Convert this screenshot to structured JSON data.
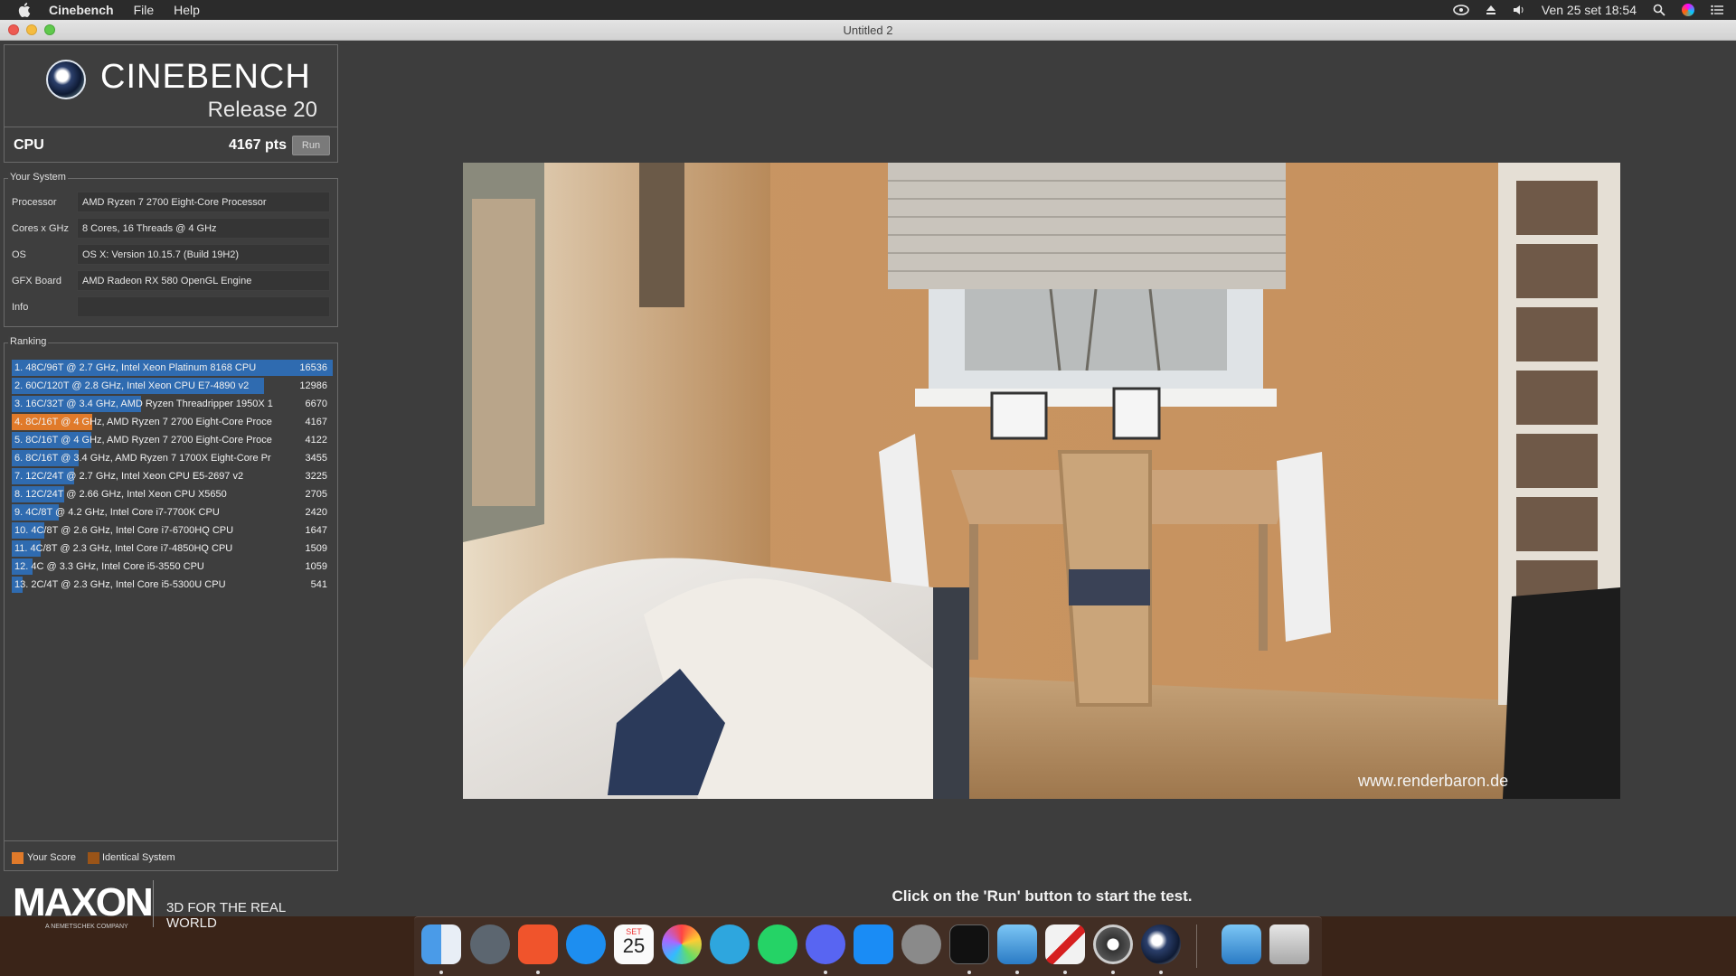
{
  "menubar": {
    "app": "Cinebench",
    "file": "File",
    "help": "Help",
    "datetime": "Ven 25 set  18:54"
  },
  "window": {
    "title": "Untitled 2"
  },
  "logo": {
    "title": "CINEBENCH",
    "subtitle": "Release 20"
  },
  "cpu": {
    "label": "CPU",
    "score": "4167 pts",
    "run": "Run"
  },
  "system": {
    "legend": "Your System",
    "rows": [
      {
        "key": "Processor",
        "value": "AMD Ryzen 7 2700 Eight-Core Processor"
      },
      {
        "key": "Cores x GHz",
        "value": "8 Cores, 16 Threads @ 4 GHz"
      },
      {
        "key": "OS",
        "value": "OS X: Version 10.15.7 (Build 19H2)"
      },
      {
        "key": "GFX Board",
        "value": "AMD Radeon RX 580 OpenGL Engine"
      },
      {
        "key": "Info",
        "value": ""
      }
    ]
  },
  "ranking": {
    "legend": "Ranking",
    "items": [
      {
        "label": "1. 48C/96T @ 2.7 GHz, Intel Xeon Platinum 8168 CPU",
        "score": "16536",
        "kind": "normal",
        "fill": 1.0
      },
      {
        "label": "2. 60C/120T @ 2.8 GHz, Intel Xeon CPU E7-4890 v2",
        "score": "12986",
        "kind": "normal",
        "fill": 0.785
      },
      {
        "label": "3. 16C/32T @ 3.4 GHz, AMD Ryzen Threadripper 1950X 1",
        "score": "6670",
        "kind": "normal",
        "fill": 0.403
      },
      {
        "label": "4. 8C/16T @ 4 GHz, AMD Ryzen 7 2700 Eight-Core Proce",
        "score": "4167",
        "kind": "your",
        "fill": 0.252
      },
      {
        "label": "5. 8C/16T @ 4 GHz, AMD Ryzen 7 2700 Eight-Core Proce",
        "score": "4122",
        "kind": "normal",
        "fill": 0.249
      },
      {
        "label": "6. 8C/16T @ 3.4 GHz, AMD Ryzen 7 1700X Eight-Core Pr",
        "score": "3455",
        "kind": "normal",
        "fill": 0.209
      },
      {
        "label": "7. 12C/24T @ 2.7 GHz, Intel Xeon CPU E5-2697 v2",
        "score": "3225",
        "kind": "normal",
        "fill": 0.195
      },
      {
        "label": "8. 12C/24T @ 2.66 GHz, Intel Xeon CPU X5650",
        "score": "2705",
        "kind": "normal",
        "fill": 0.164
      },
      {
        "label": "9. 4C/8T @ 4.2 GHz, Intel Core i7-7700K CPU",
        "score": "2420",
        "kind": "normal",
        "fill": 0.146
      },
      {
        "label": "10. 4C/8T @ 2.6 GHz, Intel Core i7-6700HQ CPU",
        "score": "1647",
        "kind": "normal",
        "fill": 0.1
      },
      {
        "label": "11. 4C/8T @ 2.3 GHz, Intel Core i7-4850HQ CPU",
        "score": "1509",
        "kind": "normal",
        "fill": 0.091
      },
      {
        "label": "12. 4C @ 3.3 GHz, Intel Core i5-3550 CPU",
        "score": "1059",
        "kind": "normal",
        "fill": 0.064
      },
      {
        "label": "13. 2C/4T @ 2.3 GHz, Intel Core i5-5300U CPU",
        "score": "541",
        "kind": "normal",
        "fill": 0.033
      }
    ],
    "your_score": "Your Score",
    "identical": "Identical System"
  },
  "footer": {
    "brand": "MAXON",
    "brand_sub": "A NEMETSCHEK COMPANY",
    "tagline": "3D FOR THE REAL WORLD"
  },
  "render": {
    "watermark": "www.renderbaron.de"
  },
  "status": "Click on the 'Run' button to start the test.",
  "colors": {
    "your": "#e07a2a",
    "identical": "#9a5418",
    "bar": "#2f6bb0"
  },
  "dock": [
    "finder-icon",
    "launchpad-icon",
    "brave-icon",
    "testflight-icon",
    "calendar-icon",
    "photos-icon",
    "telegram-icon",
    "whatsapp-icon",
    "discord-icon",
    "app-store-icon",
    "system-preferences-icon",
    "terminal-icon",
    "istat-icon",
    "pdf-icon",
    "davinci-icon",
    "cinebench-icon",
    "downloads-icon",
    "trash-icon"
  ],
  "dock_calendar": {
    "month": "SET",
    "day": "25"
  }
}
